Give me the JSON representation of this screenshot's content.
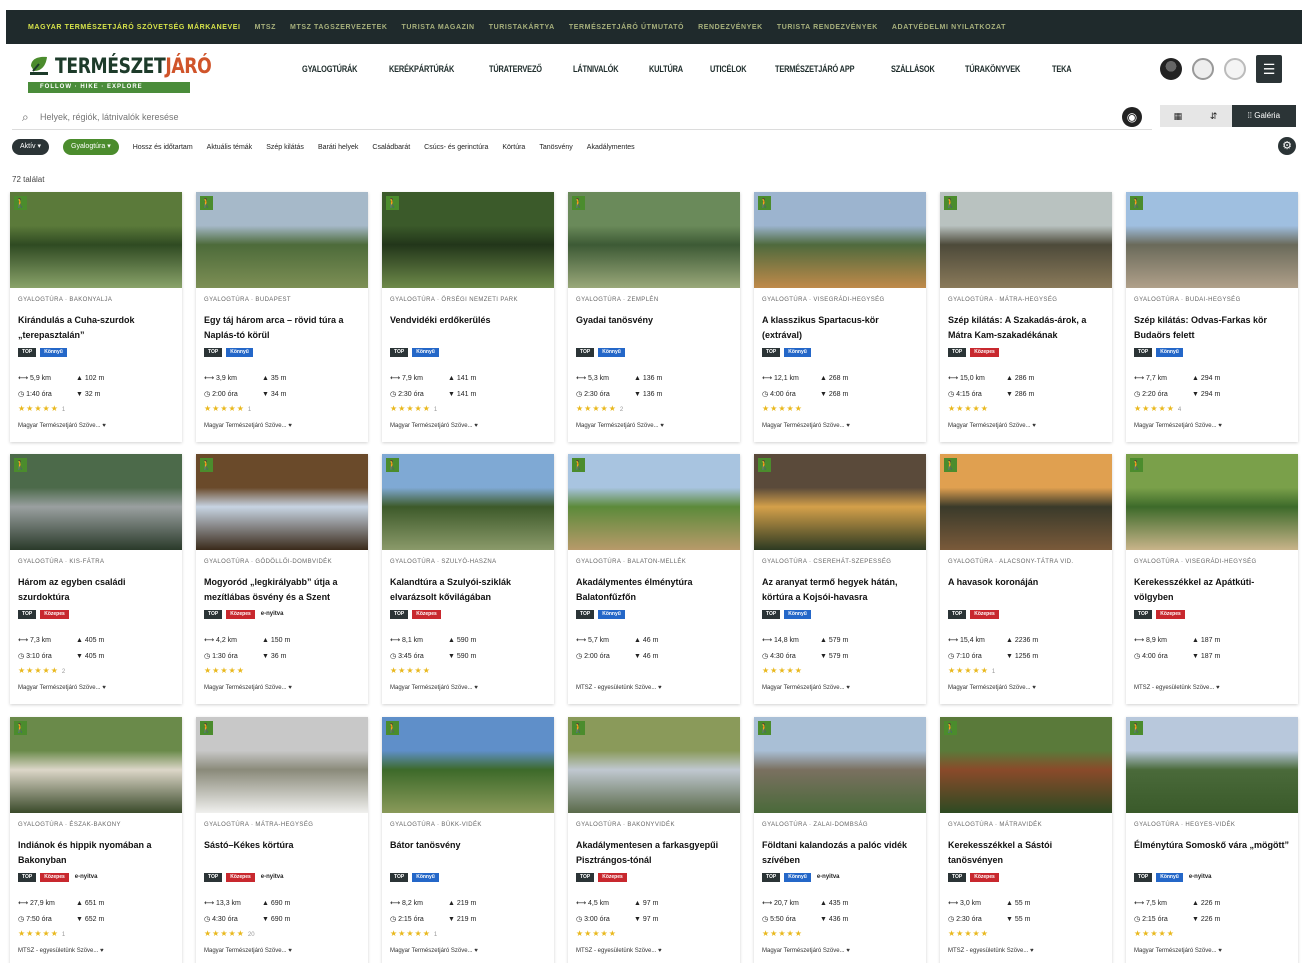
{
  "topbar": {
    "items": [
      "MAGYAR TERMÉSZETJÁRÓ SZÖVETSÉG MÁRKANEVEI",
      "MTSZ",
      "MTSZ TAGSZERVEZETEK",
      "TURISTA MAGAZIN",
      "TURISTAKÁRTYA",
      "TERMÉSZETJÁRÓ ÚTMUTATÓ",
      "RENDEZVÉNYEK",
      "TURISTA RENDEZVÉNYEK",
      "ADATVÉDELMI NYILATKOZAT"
    ]
  },
  "brand": {
    "name_main": "TERMÉSZET",
    "name_accent": "JÁRÓ",
    "tagline": "FOLLOW · HIKE · EXPLORE"
  },
  "nav": {
    "items": [
      "GYALOGTÚRÁK",
      "KERÉKPÁRTÚRÁK",
      "TÚRATERVEZŐ",
      "LÁTNIVALÓK",
      "KULTÚRA",
      "UTICÉLOK",
      "TERMÉSZETJÁRÓ APP",
      "SZÁLLÁSOK",
      "TÚRAKÖNYVEK",
      "TEKA"
    ],
    "menu_icon": "hamburger-icon"
  },
  "search": {
    "placeholder": "Helyek, régiók, látnivalók keresése",
    "views": [
      "▦",
      "⇵",
      "⁞⁞ Galéria"
    ]
  },
  "filters": {
    "chips": [
      "Aktív ▾",
      "Gyalogtúra ▾"
    ],
    "options": [
      "Hossz és időtartam",
      "Aktuális témák",
      "Szép kilátás",
      "Baráti helyek",
      "Családbarát",
      "Csúcs- és gerinctúra",
      "Körtúra",
      "Tanösvény",
      "Akadálymentes"
    ]
  },
  "results_count": "72 találat",
  "cards": [
    {
      "category": "GYALOGTÚRA · BAKONYALJA",
      "title": "Kirándulás a Cuha-szurdok „terepasztalán”",
      "tags": [
        "TOP",
        "Könnyű"
      ],
      "tag_colors": [
        "top",
        "blue"
      ],
      "distance": "5,9 km",
      "ascent": "102 m",
      "duration": "1:40 óra",
      "descent": "32 m",
      "stars": "★★★★★",
      "rating_count": "1",
      "author": "Magyar Természetjáró Szöve... ♥"
    },
    {
      "category": "GYALOGTÚRA · BUDAPEST",
      "title": "Egy táj három arca – rövid túra a Naplás-tó körül",
      "tags": [
        "TOP",
        "Könnyű"
      ],
      "tag_colors": [
        "top",
        "blue"
      ],
      "distance": "3,9 km",
      "ascent": "35 m",
      "duration": "2:00 óra",
      "descent": "34 m",
      "stars": "★★★★★",
      "rating_count": "1",
      "author": "Magyar Természetjáró Szöve... ♥"
    },
    {
      "category": "GYALOGTÚRA · ÖRSÉGI NEMZETI PARK",
      "title": "Vendvidéki erdőkerülés",
      "tags": [
        "TOP",
        "Könnyű"
      ],
      "tag_colors": [
        "top",
        "blue"
      ],
      "distance": "7,9 km",
      "ascent": "141 m",
      "duration": "2:30 óra",
      "descent": "141 m",
      "stars": "★★★★★",
      "rating_count": "1",
      "author": "Magyar Természetjáró Szöve... ♥"
    },
    {
      "category": "GYALOGTÚRA · ZEMPLÉN",
      "title": "Gyadai tanösvény",
      "tags": [
        "TOP",
        "Könnyű"
      ],
      "tag_colors": [
        "top",
        "blue"
      ],
      "distance": "5,3 km",
      "ascent": "136 m",
      "duration": "2:30 óra",
      "descent": "136 m",
      "stars": "★★★★★",
      "rating_count": "2",
      "author": "Magyar Természetjáró Szöve... ♥"
    },
    {
      "category": "GYALOGTÚRA · VISEGRÁDI-HEGYSÉG",
      "title": "A klasszikus Spartacus-kör (extrával)",
      "tags": [
        "TOP",
        "Könnyű"
      ],
      "tag_colors": [
        "top",
        "blue"
      ],
      "distance": "12,1 km",
      "ascent": "268 m",
      "duration": "4:00 óra",
      "descent": "268 m",
      "stars": "★★★★★",
      "rating_count": "",
      "author": "Magyar Természetjáró Szöve... ♥"
    },
    {
      "category": "GYALOGTÚRA · MÁTRA-HEGYSÉG",
      "title": "Szép kilátás: A Szakadás-árok, a Mátra Kam-szakadékának",
      "tags": [
        "TOP",
        "Közepes"
      ],
      "tag_colors": [
        "top",
        "red"
      ],
      "distance": "15,0 km",
      "ascent": "286 m",
      "duration": "4:15 óra",
      "descent": "286 m",
      "stars": "★★★★★",
      "rating_count": "",
      "author": "Magyar Természetjáró Szöve... ♥"
    },
    {
      "category": "GYALOGTÚRA · BUDAI-HEGYSÉG",
      "title": "Szép kilátás: Odvas-Farkas kör Budaörs felett",
      "tags": [
        "TOP",
        "Könnyű"
      ],
      "tag_colors": [
        "top",
        "blue"
      ],
      "distance": "7,7 km",
      "ascent": "294 m",
      "duration": "2:20 óra",
      "descent": "294 m",
      "stars": "★★★★★",
      "rating_count": "4",
      "author": "Magyar Természetjáró Szöve... ♥"
    },
    {
      "category": "GYALOGTÚRA · KIS-FÁTRA",
      "title": "Három az egyben családi szurdoktúra",
      "tags": [
        "TOP",
        "Közepes"
      ],
      "tag_colors": [
        "top",
        "red"
      ],
      "distance": "7,3 km",
      "ascent": "405 m",
      "duration": "3:10 óra",
      "descent": "405 m",
      "stars": "★★★★★",
      "rating_count": "2",
      "author": "Magyar Természetjáró Szöve... ♥"
    },
    {
      "category": "GYALOGTÚRA · GÖDÖLLŐI-DOMBVIDÉK",
      "title": "Mogyoród „legkirályabb” útja a mezítlábas ösvény és a Szent",
      "tags": [
        "TOP",
        "Közepes",
        "e-nyitva"
      ],
      "tag_colors": [
        "top",
        "red",
        "plain"
      ],
      "distance": "4,2 km",
      "ascent": "150 m",
      "duration": "1:30 óra",
      "descent": "36 m",
      "stars": "★★★★★",
      "rating_count": "",
      "author": "Magyar Természetjáró Szöve... ♥"
    },
    {
      "category": "GYALOGTÚRA · SZULYÓ-HASZNA",
      "title": "Kalandtúra a Szulyói-sziklák elvarázsolt kővilágában",
      "tags": [
        "TOP",
        "Közepes"
      ],
      "tag_colors": [
        "top",
        "red"
      ],
      "distance": "8,1 km",
      "ascent": "590 m",
      "duration": "3:45 óra",
      "descent": "590 m",
      "stars": "★★★★★",
      "rating_count": "",
      "author": "Magyar Természetjáró Szöve... ♥"
    },
    {
      "category": "GYALOGTÚRA · BALATON-MELLÉK",
      "title": "Akadálymentes élménytúra Balatonfűzfőn",
      "tags": [
        "TOP",
        "Könnyű"
      ],
      "tag_colors": [
        "top",
        "blue"
      ],
      "distance": "5,7 km",
      "ascent": "46 m",
      "duration": "2:00 óra",
      "descent": "46 m",
      "stars": "",
      "rating_count": "",
      "author": "MTSZ - egyesületünk Szöve... ♥"
    },
    {
      "category": "GYALOGTÚRA · CSEREHÁT-SZEPESSÉG",
      "title": "Az aranyat termő hegyek hátán, körtúra a Kojsói-havasra",
      "tags": [
        "TOP",
        "Könnyű"
      ],
      "tag_colors": [
        "top",
        "blue"
      ],
      "distance": "14,8 km",
      "ascent": "579 m",
      "duration": "4:30 óra",
      "descent": "579 m",
      "stars": "★★★★★",
      "rating_count": "",
      "author": "Magyar Természetjáró Szöve... ♥"
    },
    {
      "category": "GYALOGTÚRA · ALACSONY-TÁTRA VID.",
      "title": "A havasok koronáján",
      "tags": [
        "TOP",
        "Közepes"
      ],
      "tag_colors": [
        "top",
        "red"
      ],
      "distance": "15,4 km",
      "ascent": "2236 m",
      "duration": "7:10 óra",
      "descent": "1256 m",
      "stars": "★★★★★",
      "rating_count": "1",
      "author": "Magyar Természetjáró Szöve... ♥"
    },
    {
      "category": "GYALOGTÚRA · VISEGRÁDI-HEGYSÉG",
      "title": "Kerekesszékkel az Apátkúti-völgyben",
      "tags": [
        "TOP",
        "Közepes"
      ],
      "tag_colors": [
        "top",
        "red"
      ],
      "distance": "8,9 km",
      "ascent": "187 m",
      "duration": "4:00 óra",
      "descent": "187 m",
      "stars": "",
      "rating_count": "",
      "author": "MTSZ - egyesületünk Szöve... ♥"
    },
    {
      "category": "GYALOGTÚRA · ÉSZAK-BAKONY",
      "title": "Indiánok és hippik nyomában a Bakonyban",
      "tags": [
        "TOP",
        "Közepes",
        "e-nyitva"
      ],
      "tag_colors": [
        "top",
        "red",
        "plain"
      ],
      "distance": "27,9 km",
      "ascent": "651 m",
      "duration": "7:50 óra",
      "descent": "652 m",
      "stars": "★★★★★",
      "rating_count": "1",
      "author": "MTSZ - egyesületünk Szöve... ♥"
    },
    {
      "category": "GYALOGTÚRA · MÁTRA-HEGYSÉG",
      "title": "Sástó–Kékes körtúra",
      "tags": [
        "TOP",
        "Közepes",
        "e-nyitva"
      ],
      "tag_colors": [
        "top",
        "red",
        "plain"
      ],
      "distance": "13,3 km",
      "ascent": "690 m",
      "duration": "4:30 óra",
      "descent": "690 m",
      "stars": "★★★★★",
      "rating_count": "20",
      "author": "Magyar Természetjáró Szöve... ♥"
    },
    {
      "category": "GYALOGTÚRA · BÜKK-VIDÉK",
      "title": "Bátor tanösvény",
      "tags": [
        "TOP",
        "Könnyű"
      ],
      "tag_colors": [
        "top",
        "blue"
      ],
      "distance": "8,2 km",
      "ascent": "219 m",
      "duration": "2:15 óra",
      "descent": "219 m",
      "stars": "★★★★★",
      "rating_count": "1",
      "author": "Magyar Természetjáró Szöve... ♥"
    },
    {
      "category": "GYALOGTÚRA · BAKONYVIDÉK",
      "title": "Akadálymentesen a farkasgyepűi Pisztrángos-tónál",
      "tags": [
        "TOP",
        "Közepes"
      ],
      "tag_colors": [
        "top",
        "red"
      ],
      "distance": "4,5 km",
      "ascent": "97 m",
      "duration": "3:00 óra",
      "descent": "97 m",
      "stars": "★★★★★",
      "rating_count": "",
      "author": "MTSZ - egyesületünk Szöve... ♥"
    },
    {
      "category": "GYALOGTÚRA · ZALAI-DOMBSÁG",
      "title": "Földtani kalandozás a palóc vidék szívében",
      "tags": [
        "TOP",
        "Könnyű",
        "e-nyitva"
      ],
      "tag_colors": [
        "top",
        "blue",
        "plain"
      ],
      "distance": "20,7 km",
      "ascent": "435 m",
      "duration": "5:50 óra",
      "descent": "436 m",
      "stars": "★★★★★",
      "rating_count": "",
      "author": "Magyar Természetjáró Szöve... ♥"
    },
    {
      "category": "GYALOGTÚRA · MÁTRAVIDÉK",
      "title": "Kerekesszékkel a Sástói tanösvényen",
      "tags": [
        "TOP",
        "Közepes"
      ],
      "tag_colors": [
        "top",
        "red"
      ],
      "distance": "3,0 km",
      "ascent": "55 m",
      "duration": "2:30 óra",
      "descent": "55 m",
      "stars": "★★★★★",
      "rating_count": "",
      "author": "MTSZ - egyesületünk Szöve... ♥"
    },
    {
      "category": "GYALOGTÚRA · HEGYES-VIDÉK",
      "title": "Élménytúra Somoskő vára „mögött”",
      "tags": [
        "TOP",
        "Könnyű",
        "e-nyitva"
      ],
      "tag_colors": [
        "top",
        "blue",
        "plain"
      ],
      "distance": "7,5 km",
      "ascent": "226 m",
      "duration": "2:15 óra",
      "descent": "226 m",
      "stars": "★★★★★",
      "rating_count": "",
      "author": "Magyar Természetjáró Szöve... ♥"
    }
  ],
  "colors": {
    "brand_green": "#4b8c2d",
    "dark": "#2b3436",
    "easy_blue": "#2467c8",
    "medium_red": "#c8282e",
    "star": "#e9b81d"
  }
}
